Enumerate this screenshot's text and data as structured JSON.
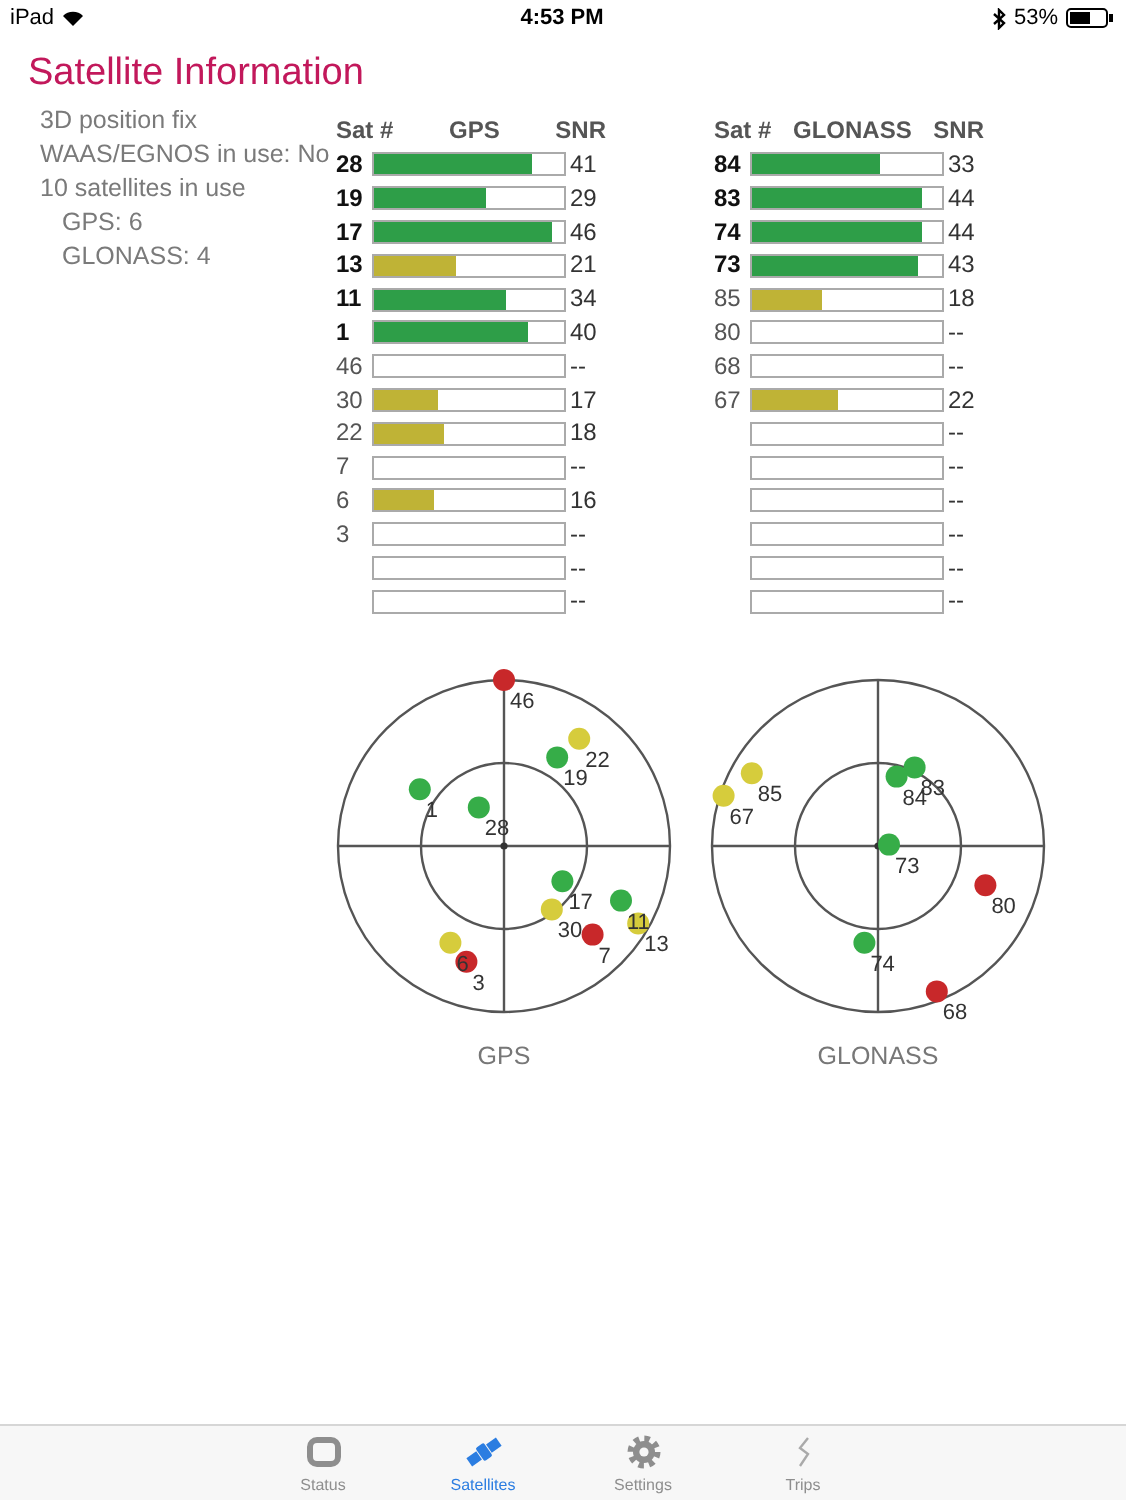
{
  "status_bar": {
    "device": "iPad",
    "time": "4:53 PM",
    "battery": "53%"
  },
  "title": "Satellite Information",
  "info": [
    {
      "text": "3D position fix",
      "indented": false
    },
    {
      "text": "WAAS/EGNOS in use: No",
      "indented": false
    },
    {
      "text": "10 satellites in use",
      "indented": false
    },
    {
      "text": "GPS: 6",
      "indented": true
    },
    {
      "text": "GLONASS: 4",
      "indented": true
    }
  ],
  "tables": [
    {
      "columns": [
        "Sat #",
        "GPS",
        "SNR"
      ],
      "rows": [
        {
          "sat": "28",
          "used": true,
          "level": 0.83,
          "color": "#2e9e48",
          "snr": "41"
        },
        {
          "sat": "19",
          "used": true,
          "level": 0.59,
          "color": "#2e9e48",
          "snr": "29"
        },
        {
          "sat": "17",
          "used": true,
          "level": 0.94,
          "color": "#2e9e48",
          "snr": "46"
        },
        {
          "sat": "13",
          "used": true,
          "level": 0.43,
          "color": "#bfb336",
          "snr": "21"
        },
        {
          "sat": "11",
          "used": true,
          "level": 0.69,
          "color": "#2e9e48",
          "snr": "34"
        },
        {
          "sat": "1",
          "used": true,
          "level": 0.81,
          "color": "#2e9e48",
          "snr": "40"
        },
        {
          "sat": "46",
          "used": false,
          "snr": "--"
        },
        {
          "sat": "30",
          "used": false,
          "level": 0.34,
          "color": "#bfb336",
          "snr": "17"
        },
        {
          "sat": "22",
          "used": false,
          "level": 0.37,
          "color": "#bfb336",
          "snr": "18"
        },
        {
          "sat": "7",
          "used": false,
          "snr": "--"
        },
        {
          "sat": "6",
          "used": false,
          "level": 0.32,
          "color": "#bfb336",
          "snr": "16"
        },
        {
          "sat": "3",
          "used": false,
          "snr": "--"
        },
        {
          "snr": "--"
        },
        {
          "snr": "--"
        }
      ]
    },
    {
      "columns": [
        "Sat #",
        "GLONASS",
        "SNR"
      ],
      "rows": [
        {
          "sat": "84",
          "used": true,
          "level": 0.67,
          "color": "#2e9e48",
          "snr": "33"
        },
        {
          "sat": "83",
          "used": true,
          "level": 0.89,
          "color": "#2e9e48",
          "snr": "44"
        },
        {
          "sat": "74",
          "used": true,
          "level": 0.89,
          "color": "#2e9e48",
          "snr": "44"
        },
        {
          "sat": "73",
          "used": true,
          "level": 0.87,
          "color": "#2e9e48",
          "snr": "43"
        },
        {
          "sat": "85",
          "used": false,
          "level": 0.37,
          "color": "#bfb336",
          "snr": "18"
        },
        {
          "sat": "80",
          "used": false,
          "snr": "--"
        },
        {
          "sat": "68",
          "used": false,
          "snr": "--"
        },
        {
          "sat": "67",
          "used": false,
          "level": 0.45,
          "color": "#bfb336",
          "snr": "22"
        },
        {
          "snr": "--"
        },
        {
          "snr": "--"
        },
        {
          "snr": "--"
        },
        {
          "snr": "--"
        },
        {
          "snr": "--"
        },
        {
          "snr": "--"
        }
      ]
    }
  ],
  "sky_plots": [
    {
      "caption": "GPS",
      "satellites": [
        {
          "label": "46",
          "color": "#c8282a"
        },
        {
          "label": "22",
          "color": "#d6cc3c"
        },
        {
          "label": "19",
          "color": "#36ad48"
        },
        {
          "label": "1",
          "color": "#36ad48"
        },
        {
          "label": "28",
          "color": "#36ad48"
        },
        {
          "label": "17",
          "color": "#36ad48"
        },
        {
          "label": "30",
          "color": "#d6cc3c"
        },
        {
          "label": "11",
          "color": "#36ad48"
        },
        {
          "label": "13",
          "color": "#d6cc3c"
        },
        {
          "label": "7",
          "color": "#c8282a"
        },
        {
          "label": "3",
          "color": "#c8282a"
        },
        {
          "label": "6",
          "color": "#d6cc3c"
        }
      ]
    },
    {
      "caption": "GLONASS",
      "satellites": [
        {
          "label": "85",
          "color": "#d6cc3c"
        },
        {
          "label": "67",
          "color": "#d6cc3c"
        },
        {
          "label": "83",
          "color": "#36ad48"
        },
        {
          "label": "84",
          "color": "#36ad48"
        },
        {
          "label": "73",
          "color": "#36ad48"
        },
        {
          "label": "80",
          "color": "#c8282a"
        },
        {
          "label": "74",
          "color": "#36ad48"
        },
        {
          "label": "68",
          "color": "#c8282a"
        }
      ]
    }
  ],
  "tabs": [
    {
      "label": "Status",
      "kind": "status",
      "selected": false
    },
    {
      "label": "Satellites",
      "kind": "satellite",
      "selected": true
    },
    {
      "label": "Settings",
      "kind": "gear",
      "selected": false
    },
    {
      "label": "Trips",
      "kind": "trips",
      "selected": false
    }
  ]
}
